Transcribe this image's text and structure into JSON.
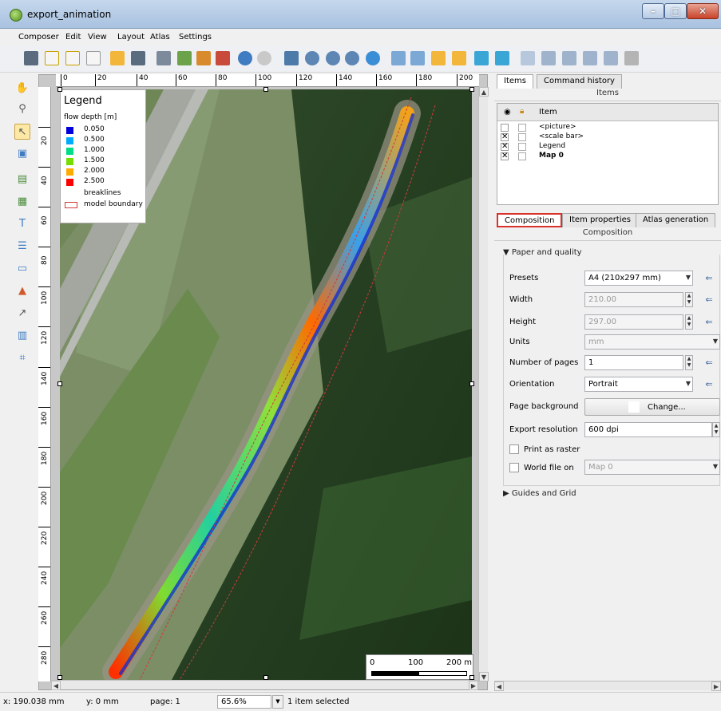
{
  "window": {
    "title": "export_animation"
  },
  "menu": [
    "Composer",
    "Edit",
    "View",
    "Layout",
    "Atlas",
    "Settings"
  ],
  "ruler": {
    "h_ticks": [
      "0",
      "20",
      "40",
      "60",
      "80",
      "100",
      "120",
      "140",
      "160",
      "180",
      "200"
    ],
    "v_ticks": [
      "20",
      "40",
      "60",
      "80",
      "100",
      "120",
      "140",
      "160",
      "180",
      "200",
      "220",
      "240",
      "260",
      "280"
    ]
  },
  "legend": {
    "title": "Legend",
    "subtitle": "flow depth [m]",
    "items": [
      {
        "label": "0.050",
        "color": "#0000dd"
      },
      {
        "label": "0.500",
        "color": "#00aaff"
      },
      {
        "label": "1.000",
        "color": "#00dd88"
      },
      {
        "label": "1.500",
        "color": "#77dd00"
      },
      {
        "label": "2.000",
        "color": "#ffaa00"
      },
      {
        "label": "2.500",
        "color": "#ff0000"
      }
    ],
    "breaklines": "breaklines",
    "boundary": "model boundary"
  },
  "scalebar": {
    "l0": "0",
    "l1": "100",
    "l2": "200 m"
  },
  "panel": {
    "tabs_top": [
      "Items",
      "Command history"
    ],
    "items_header": "Items",
    "column_item": "Item",
    "items": [
      {
        "name": "<picture>",
        "visible": false,
        "bold": false
      },
      {
        "name": "<scale bar>",
        "visible": true,
        "bold": false
      },
      {
        "name": "Legend",
        "visible": true,
        "bold": false
      },
      {
        "name": "Map 0",
        "visible": true,
        "bold": true
      }
    ],
    "tabs_mid": [
      "Composition",
      "Item properties",
      "Atlas generation"
    ],
    "composition_header": "Composition",
    "paper_group": "Paper and quality",
    "presets_label": "Presets",
    "presets_value": "A4 (210x297 mm)",
    "width_label": "Width",
    "width_value": "210.00",
    "height_label": "Height",
    "height_value": "297.00",
    "units_label": "Units",
    "units_value": "mm",
    "pages_label": "Number of pages",
    "pages_value": "1",
    "orientation_label": "Orientation",
    "orientation_value": "Portrait",
    "background_label": "Page background",
    "background_button": "Change...",
    "resolution_label": "Export resolution",
    "resolution_value": "600 dpi",
    "raster_label": "Print as raster",
    "worldfile_label": "World file on",
    "worldfile_value": "Map 0",
    "guides_group": "Guides and Grid"
  },
  "status": {
    "x": "x: 190.038 mm",
    "y": "y: 0 mm",
    "page": "page: 1",
    "zoom": "65.6%",
    "selection": "1 item selected"
  }
}
